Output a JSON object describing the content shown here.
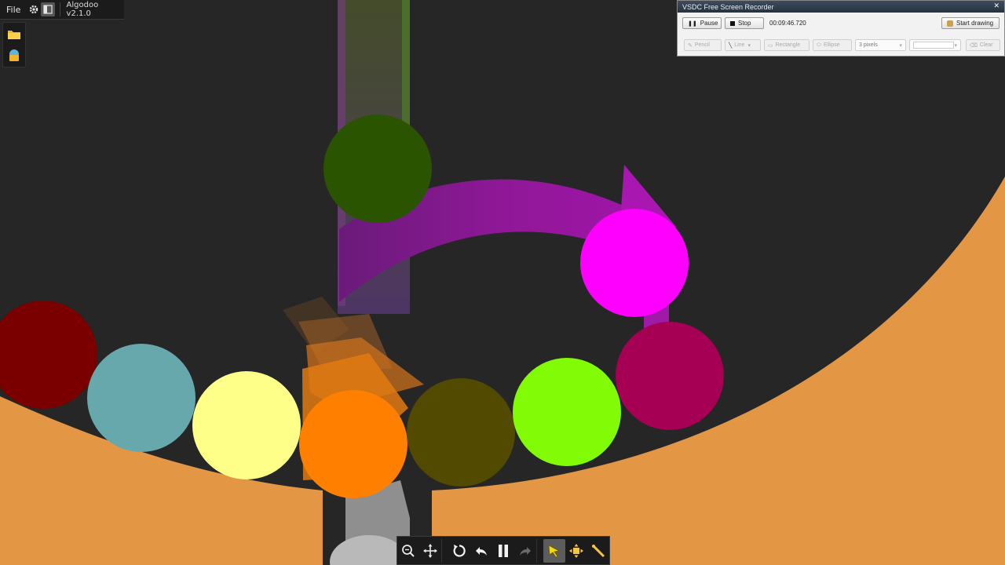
{
  "algodoo": {
    "menu": {
      "file_label": "File"
    },
    "title": "Algodoo v2.1.0",
    "icons": [
      "gear-icon",
      "layout-toggle-icon"
    ],
    "side_icons": [
      "folder-icon",
      "scene-bucket-icon"
    ]
  },
  "recorder": {
    "title": "VSDC Free Screen Recorder",
    "pause_label": "Pause",
    "stop_label": "Stop",
    "elapsed": "00:09:46.720",
    "start_drawing_label": "Start drawing",
    "tools": {
      "pencil": "Pencil",
      "line": "Line",
      "rectangle": "Rectangle",
      "ellipse": "Ellipse",
      "width": "3 pixels",
      "clear": "Clear"
    }
  },
  "toolbar": {
    "icons": [
      "zoom-icon",
      "move-icon",
      "reset-icon",
      "undo-icon",
      "pause-icon",
      "redo-icon",
      "drag-tool-icon",
      "move-tool-icon",
      "ruler-tool-icon"
    ]
  },
  "colors": {
    "background": "#262626",
    "terrain": "#e39745",
    "arrow": "#8c1898",
    "balls": {
      "darkred": "#7a0000",
      "teal": "#66a8ab",
      "lightyellow": "#feff88",
      "orange": "#ff7f00",
      "olive": "#524a00",
      "lime": "#82fb07",
      "magenta": "#fe00fe",
      "crimson": "#a50054",
      "darkgreen": "#2a5400"
    }
  }
}
